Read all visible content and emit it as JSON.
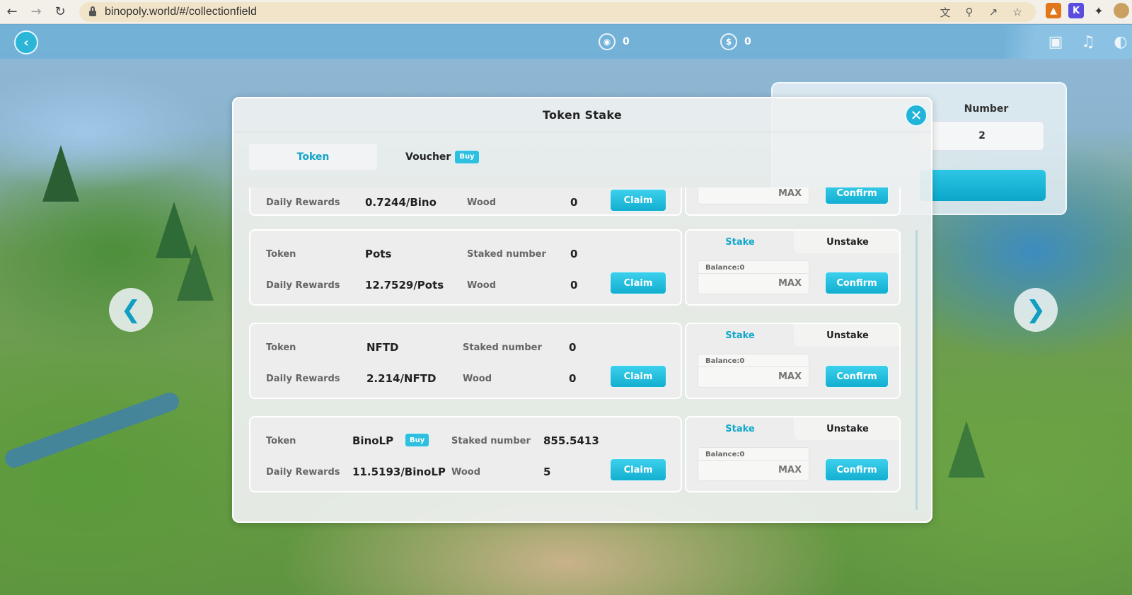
{
  "browser": {
    "url": "binopoly.world/#/collectionfield"
  },
  "game_bar": {
    "stat1_value": "0",
    "stat2_value": "0"
  },
  "bg_panel": {
    "number_label": "Number",
    "number_value": "2"
  },
  "modal": {
    "title": "Token Stake",
    "tabs": {
      "token": "Token",
      "voucher": "Voucher",
      "buy": "Buy"
    },
    "labels": {
      "token": "Token",
      "daily_rewards": "Daily Rewards",
      "staked_number": "Staked number",
      "wood": "Wood",
      "claim": "Claim",
      "stake": "Stake",
      "unstake": "Unstake",
      "balance": "Balance:0",
      "max": "MAX",
      "confirm": "Confirm",
      "buy": "Buy"
    },
    "rows": [
      {
        "token": "Bino",
        "staked_number": "",
        "daily_rewards": "0.7244/Bino",
        "wood": "0"
      },
      {
        "token": "Pots",
        "staked_number": "0",
        "daily_rewards": "12.7529/Pots",
        "wood": "0"
      },
      {
        "token": "NFTD",
        "staked_number": "0",
        "daily_rewards": "2.214/NFTD",
        "wood": "0"
      },
      {
        "token": "BinoLP",
        "staked_number": "855.5413",
        "daily_rewards": "11.5193/BinoLP",
        "wood": "5"
      }
    ]
  },
  "colors": {
    "accent": "#12aed0",
    "accent_light": "#3dd0ec",
    "text_dark": "#222222"
  },
  "icons": [
    "back-arrow-icon",
    "forward-arrow-icon",
    "reload-icon",
    "lock-icon",
    "translate-icon",
    "zoom-icon",
    "share-icon",
    "star-icon",
    "metamask-icon",
    "k-extension-icon",
    "puzzle-icon",
    "profile-icon",
    "back-icon",
    "gem-icon",
    "coin-icon",
    "shop-icon",
    "music-icon",
    "globe-icon",
    "close-icon",
    "chevron-left-icon",
    "chevron-right-icon"
  ]
}
